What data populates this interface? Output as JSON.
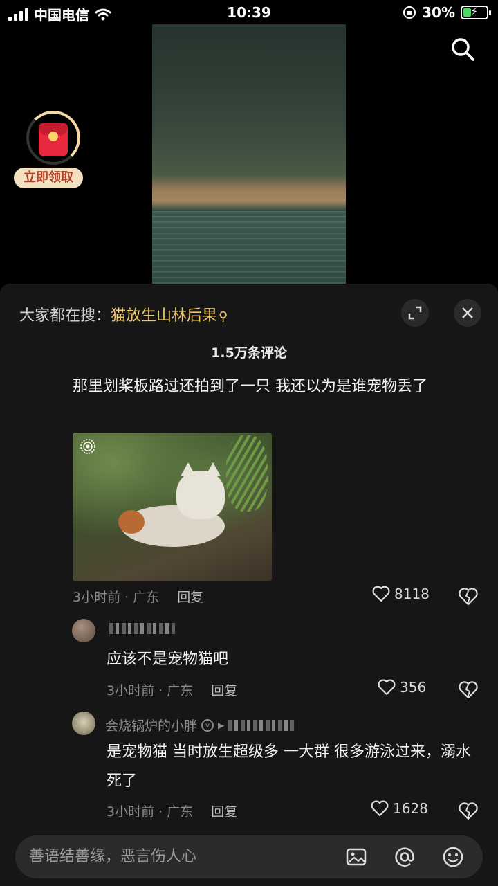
{
  "status_bar": {
    "carrier": "中国电信",
    "time": "10:39",
    "battery_text": "30%",
    "battery_level": 0.3,
    "battery_color": "#4cd964"
  },
  "red_packet": {
    "label": "立即领取",
    "icon": "red-envelope-icon"
  },
  "comments_panel": {
    "hot_search_prefix": "大家都在搜：",
    "hot_search_keyword": "猫放生山林后果",
    "comment_count": "1.5万条评论",
    "accent_color": "#f0c66b",
    "comments": [
      {
        "text": "那里划桨板路过还拍到了一只 我还以为是谁宠物丢了",
        "time_location": "3小时前 · 广东",
        "reply": "回复",
        "likes": "8118"
      }
    ],
    "replies": [
      {
        "username": "",
        "text": "应该不是宠物猫吧",
        "time_location": "3小时前 · 广东",
        "reply": "回复",
        "likes": "356"
      },
      {
        "username": "会烧锅炉的小胖",
        "text": "是宠物猫 当时放生超级多 一大群 很多游泳过来，溺水死了",
        "time_location": "3小时前 · 广东",
        "reply": "回复",
        "likes": "1628"
      }
    ],
    "input_placeholder": "善语结善缘，恶言伤人心"
  }
}
